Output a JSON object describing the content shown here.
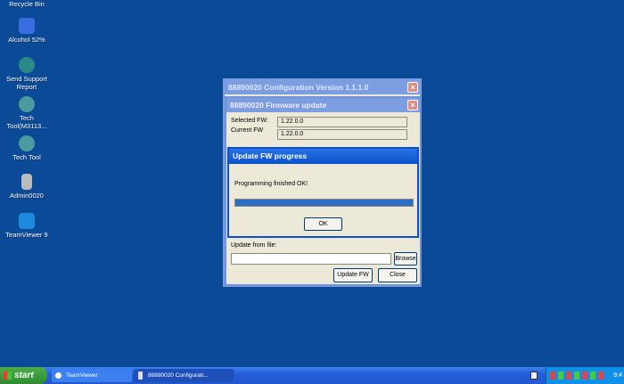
{
  "desktop": {
    "icons": [
      {
        "label": "Recycle Bin",
        "icon": "recycle-bin-icon"
      },
      {
        "label": "Alcohol 52%",
        "icon": "alcohol-icon"
      },
      {
        "label": "Send Support Report",
        "icon": "support-report-icon"
      },
      {
        "label": "Tech Tool(M3113...",
        "icon": "tech-tool-icon"
      },
      {
        "label": "Tech Tool",
        "icon": "tech-tool-icon"
      },
      {
        "label": "Admin0020",
        "icon": "admin-icon"
      },
      {
        "label": "TeamViewer 9",
        "icon": "teamviewer-icon"
      }
    ]
  },
  "config_window": {
    "title": "88890020 Configuration Version 1.1.1.0"
  },
  "fw_window": {
    "title": "88890020 Firmware update",
    "selected_fw_label": "Selected FW:",
    "selected_fw": "1.22.0.0",
    "current_fw_label": "Current FW",
    "current_fw": "1.22.0.0",
    "update_from_file_label": "Update from file:",
    "file_value": "",
    "browse": "Browse",
    "update_fw": "Update FW",
    "close": "Close"
  },
  "progress_dialog": {
    "title": "Update FW progress",
    "message": "Programming finished OK!",
    "progress_percent": 100,
    "ok": "OK"
  },
  "taskbar": {
    "start": "start",
    "items": [
      {
        "label": "TeamViewer"
      },
      {
        "label": "88890020 Configurati..."
      }
    ],
    "clock": "9:4"
  },
  "colors": {
    "desktop": "#0b4a96",
    "active_title": "#0a5ad8",
    "progress": "#2c6ec4"
  }
}
